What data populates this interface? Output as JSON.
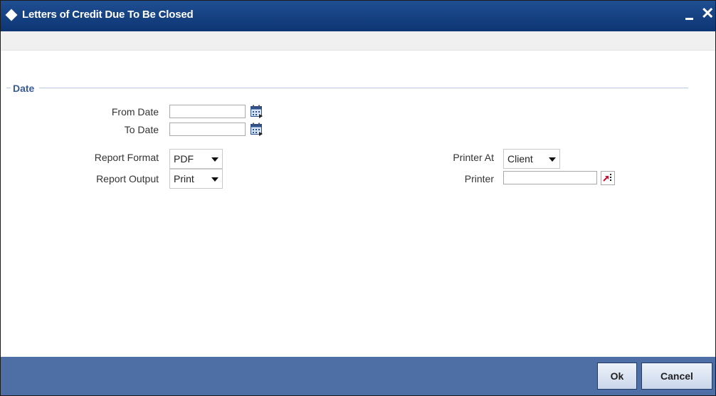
{
  "window": {
    "title": "Letters of Credit Due To Be Closed",
    "minimize_glyph": "",
    "close_glyph": "✕"
  },
  "section": {
    "title": "Date"
  },
  "fields": {
    "from_date": {
      "label": "From Date",
      "value": ""
    },
    "to_date": {
      "label": "To Date",
      "value": ""
    },
    "report_format": {
      "label": "Report Format",
      "value": "PDF"
    },
    "report_output": {
      "label": "Report Output",
      "value": "Print"
    },
    "printer_at": {
      "label": "Printer At",
      "value": "Client"
    },
    "printer": {
      "label": "Printer",
      "value": ""
    }
  },
  "buttons": {
    "ok": "Ok",
    "cancel": "Cancel"
  },
  "icons": {
    "calendar": "calendar-icon",
    "lov": "lov-search-icon",
    "dropdown": "chevron-down-icon"
  },
  "colors": {
    "titlebar": "#0d3573",
    "footer": "#4e6fa6",
    "section_title": "#3a5b98"
  }
}
